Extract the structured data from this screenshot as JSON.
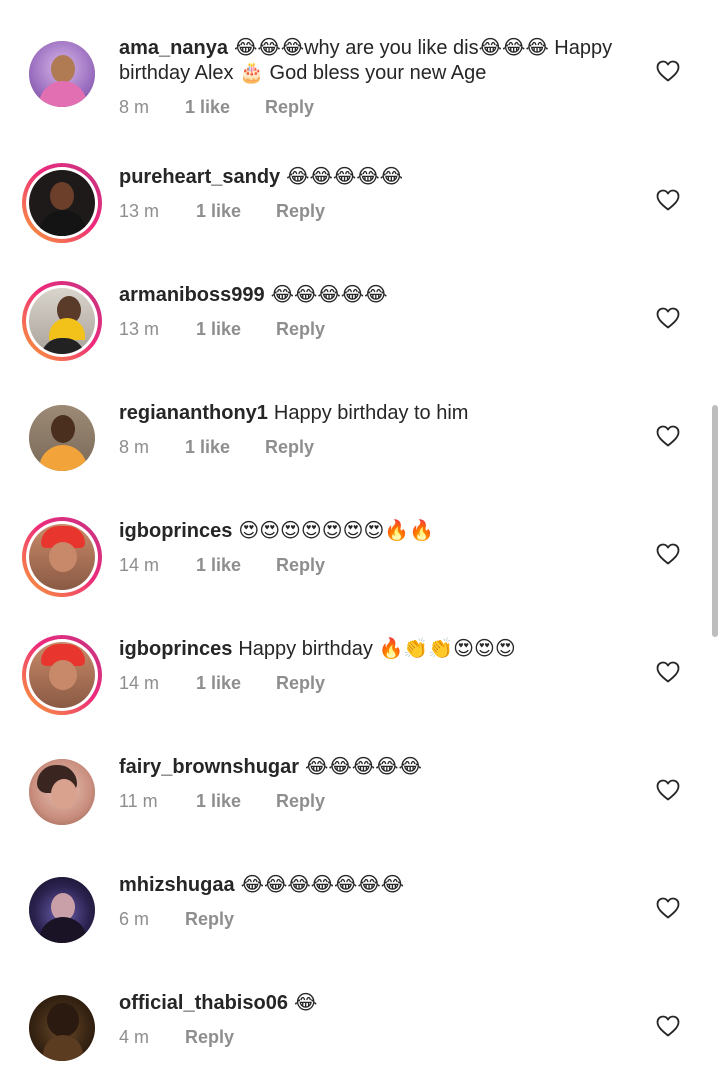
{
  "comments": [
    {
      "username": "ama_nanya",
      "text": "😂😂😂why are you like dis😂😂😂 Happy birthday Alex 🎂 God bless your new Age",
      "time": "8 m",
      "likes": "1 like",
      "reply": "Reply"
    },
    {
      "username": "pureheart_sandy",
      "text": "😂😂😂😂😂",
      "time": "13 m",
      "likes": "1 like",
      "reply": "Reply"
    },
    {
      "username": "armaniboss999",
      "text": "😂😂😂😂😂",
      "time": "13 m",
      "likes": "1 like",
      "reply": "Reply"
    },
    {
      "username": "regiananthony1",
      "text": "Happy birthday to him",
      "time": "8 m",
      "likes": "1 like",
      "reply": "Reply"
    },
    {
      "username": "igboprinces",
      "text": "😍😍😍😍😍😍😍🔥🔥",
      "time": "14 m",
      "likes": "1 like",
      "reply": "Reply"
    },
    {
      "username": "igboprinces",
      "text": "Happy birthday 🔥👏👏😍😍😍",
      "time": "14 m",
      "likes": "1 like",
      "reply": "Reply"
    },
    {
      "username": "fairy_brownshugar",
      "text": "😂😂😂😂😂",
      "time": "11 m",
      "likes": "1 like",
      "reply": "Reply"
    },
    {
      "username": "mhizshugaa",
      "text": "😂😂😂😂😂😂😂",
      "time": "6 m",
      "reply": "Reply"
    },
    {
      "username": "official_thabiso06",
      "text": "😂",
      "time": "4 m",
      "reply": "Reply"
    }
  ],
  "icons": {
    "like": "heart-outline-icon"
  },
  "colors": {
    "text": "#262626",
    "meta": "#8e8e8e",
    "story_ring_start": "#f9a334",
    "story_ring_end": "#c13584"
  }
}
